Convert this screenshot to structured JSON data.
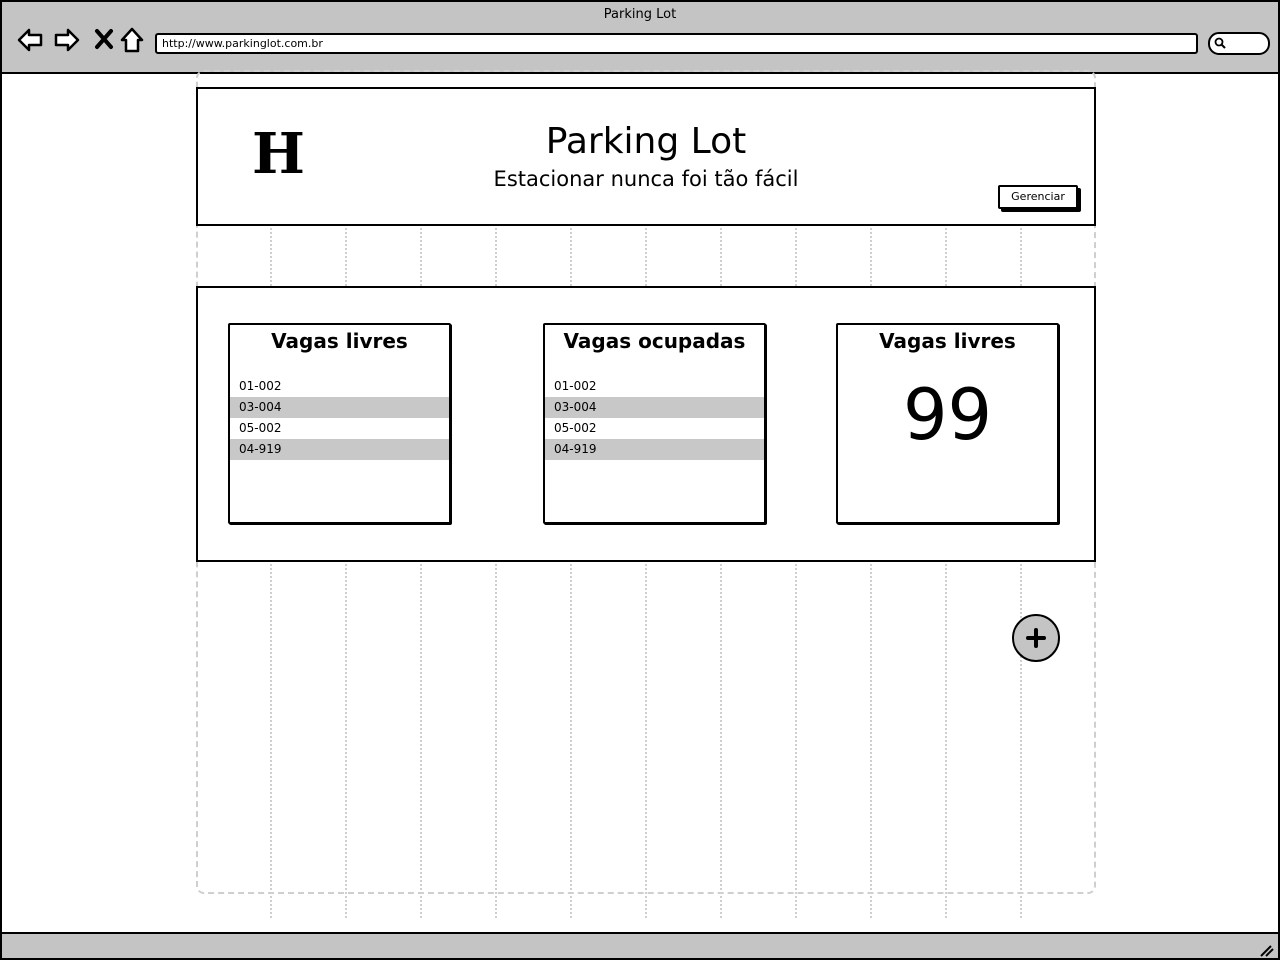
{
  "window": {
    "title": "Parking Lot"
  },
  "browser": {
    "url": "http://www.parkinglot.com.br",
    "icons": [
      "back-arrow-icon",
      "forward-arrow-icon",
      "stop-icon",
      "home-icon",
      "search-icon",
      "resize-grip-icon"
    ]
  },
  "header": {
    "logo": "H",
    "title": "Parking Lot",
    "subtitle": "Estacionar nunca foi tão fácil",
    "manage_label": "Gerenciar"
  },
  "cards": {
    "free": {
      "title": "Vagas livres",
      "items": [
        "01-002",
        "03-004",
        "05-002",
        "04-919"
      ]
    },
    "occupied": {
      "title": "Vagas ocupadas",
      "items": [
        "01-002",
        "03-004",
        "05-002",
        "04-919"
      ]
    },
    "count": {
      "title": "Vagas livres",
      "value": "99"
    }
  },
  "fab": {
    "icon": "plus-icon"
  },
  "colors": {
    "chrome": "#c4c4c4",
    "row_highlight": "#c8c8c8",
    "grid_guide": "#cfcfcf"
  }
}
